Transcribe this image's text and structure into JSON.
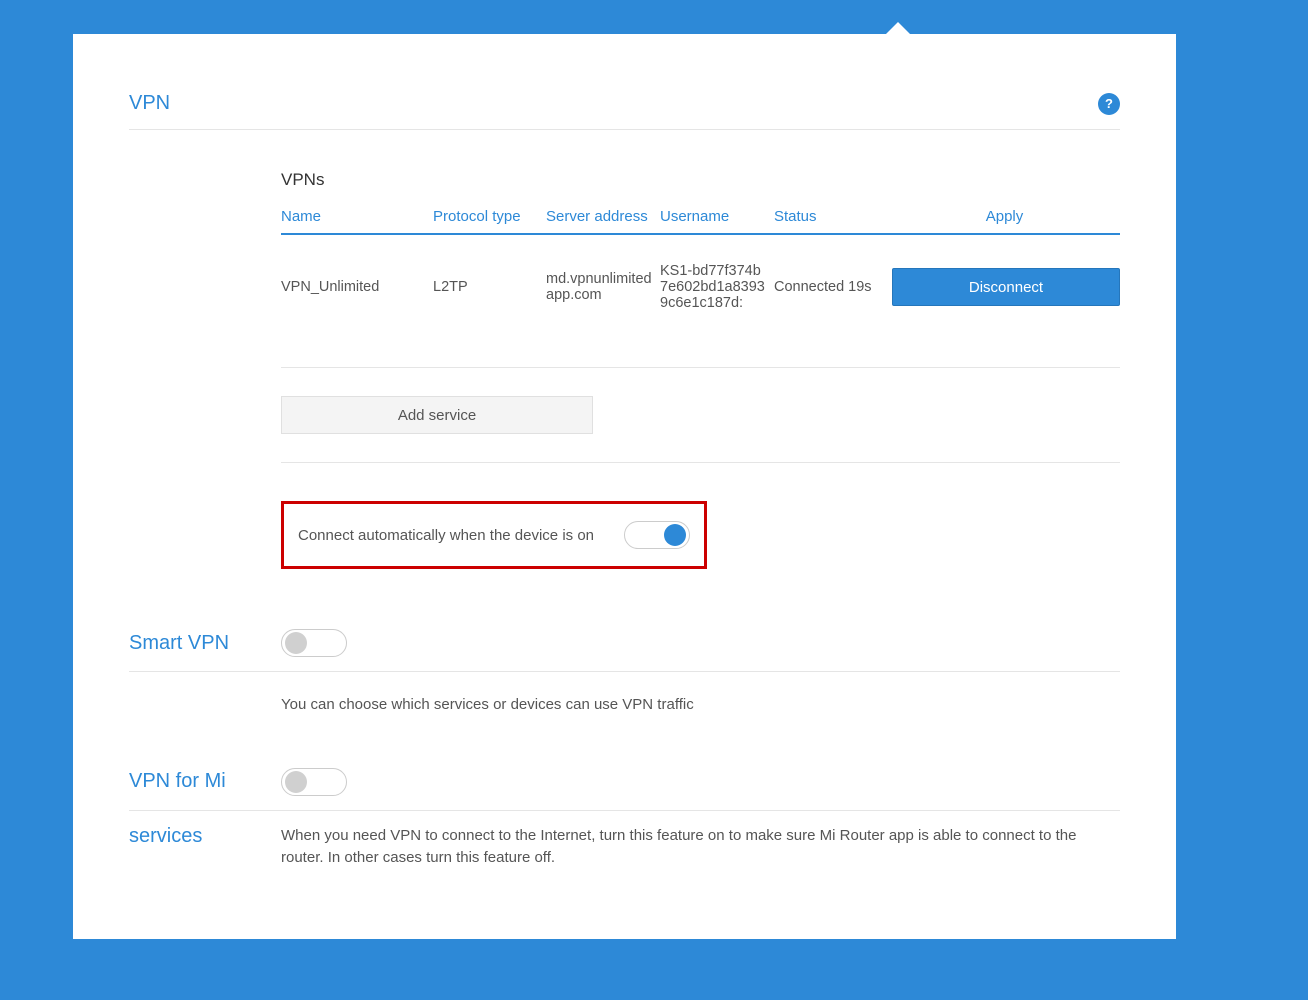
{
  "vpn": {
    "title": "VPN",
    "table_title": "VPNs",
    "headers": {
      "name": "Name",
      "protocol": "Protocol type",
      "server": "Server address",
      "username": "Username",
      "status": "Status",
      "apply": "Apply"
    },
    "rows": [
      {
        "name": "VPN_Unlimited",
        "protocol": "L2TP",
        "server": "md.vpnunlimitedapp.com",
        "username": "KS1-bd77f374b7e602bd1a83939c6e1c187d:",
        "status": "Connected 19s",
        "action": "Disconnect"
      }
    ],
    "add_service": "Add service",
    "auto_connect": {
      "label": "Connect automatically when the device is on",
      "enabled": true
    }
  },
  "smart_vpn": {
    "title": "Smart VPN",
    "enabled": false,
    "description": "You can choose which services or devices can use VPN traffic"
  },
  "vpn_for_mi": {
    "title_line1": "VPN for Mi",
    "title_line2": "services",
    "enabled": false,
    "description": "When you need VPN to connect to the Internet, turn this feature on to make sure Mi Router app is able to connect to the router. In other cases turn this feature off."
  },
  "help_icon": "?"
}
